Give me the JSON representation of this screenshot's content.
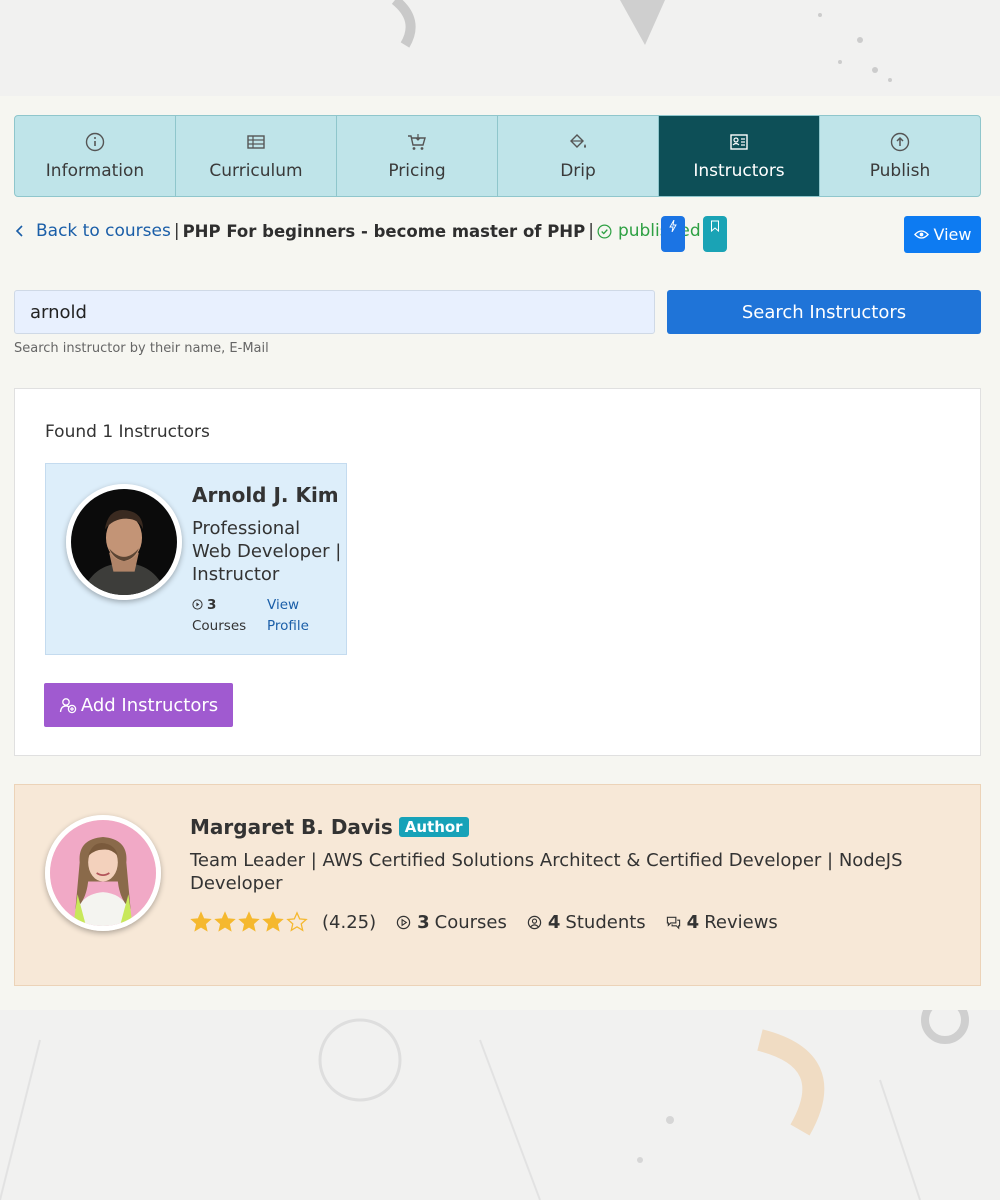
{
  "tabs": [
    {
      "label": "Information",
      "icon": "info-icon"
    },
    {
      "label": "Curriculum",
      "icon": "list-icon"
    },
    {
      "label": "Pricing",
      "icon": "cart-icon"
    },
    {
      "label": "Drip",
      "icon": "paint-bucket-icon"
    },
    {
      "label": "Instructors",
      "icon": "id-card-icon",
      "active": true
    },
    {
      "label": "Publish",
      "icon": "upload-icon"
    }
  ],
  "breadcrumb": {
    "back_label": "Back to courses",
    "separator": "|",
    "course_title": "PHP For beginners - become master of PHP",
    "status": "published"
  },
  "toolbar": {
    "view_label": "View"
  },
  "search": {
    "value": "arnold",
    "button_label": "Search Instructors",
    "hint": "Search instructor by their name, E-Mail"
  },
  "results": {
    "found_text": "Found 1 Instructors",
    "instructor": {
      "name": "Arnold J. Kim",
      "role": "Professional Web Developer | Instructor",
      "courses_count": "3",
      "courses_label": "Courses",
      "profile_link": "View Profile"
    },
    "add_button_label": "Add Instructors"
  },
  "author": {
    "name": "Margaret B. Davis",
    "badge": "Author",
    "bio": "Team Leader | AWS Certified Solutions Architect & Certified Developer | NodeJS Developer",
    "rating_value": 4.25,
    "rating_text": "(4.25)",
    "courses_count": "3",
    "courses_label": "Courses",
    "students_count": "4",
    "students_label": "Students",
    "reviews_count": "4",
    "reviews_label": "Reviews"
  },
  "colors": {
    "tab_bg": "#bfe4e9",
    "tab_active": "#0d4f57",
    "primary": "#1f74d8",
    "purple": "#a05ad0",
    "success": "#2ea043",
    "star": "#f5b82e"
  }
}
